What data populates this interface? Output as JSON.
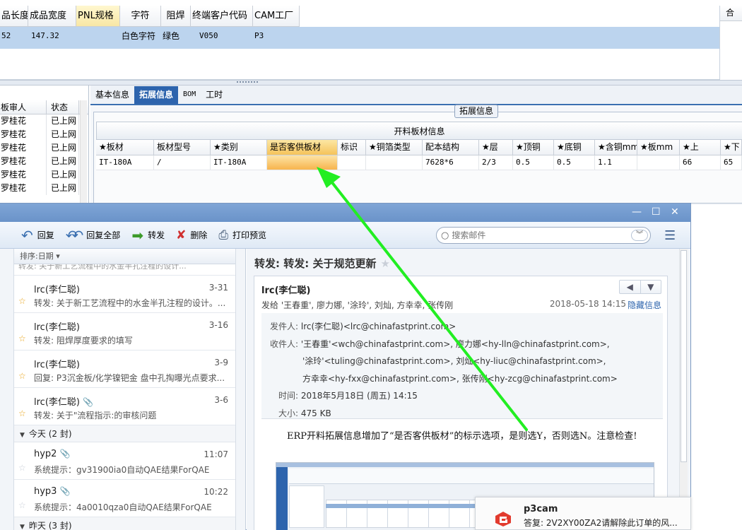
{
  "erp": {
    "grid": {
      "headers": [
        "品长度",
        "成品宽度",
        "PNL规格",
        "字符",
        "阻焊",
        "终端客户代码",
        "CAM工厂"
      ],
      "row": [
        "52",
        "147.32",
        "",
        "白色字符",
        "绿色",
        "V050",
        "P3",
        ""
      ],
      "right_header": "合"
    },
    "left_panel": {
      "headers": [
        "板审人",
        "状态"
      ],
      "rows": [
        [
          "罗桂花",
          "已上网"
        ],
        [
          "罗桂花",
          "已上网"
        ],
        [
          "罗桂花",
          "已上网"
        ],
        [
          "罗桂花",
          "已上网"
        ],
        [
          "罗桂花",
          "已上网"
        ],
        [
          "罗桂花",
          "已上网"
        ]
      ]
    },
    "tabs": [
      {
        "label": "基本信息",
        "active": false
      },
      {
        "label": "拓展信息",
        "active": true
      },
      {
        "label": "BOM",
        "active": false
      },
      {
        "label": "工时",
        "active": false
      }
    ],
    "group_title": "拓展信息",
    "sub_title": "开料板材信息",
    "sub_headers": [
      "★板材",
      "板材型号",
      "★类别",
      "是否客供板材",
      "标识",
      "★铜箔类型",
      "配本结构",
      "★层",
      "★顶铜",
      "★底铜",
      "★含铜mm",
      "★板mm",
      "★上",
      "★下"
    ],
    "sub_row": [
      "IT-180A",
      "/",
      "IT-180A",
      "",
      "",
      "",
      "7628*6",
      "2/3",
      "0.5",
      "0.5",
      "1.1",
      "",
      "66",
      "65"
    ]
  },
  "mail": {
    "window_controls": [
      "—",
      "☐",
      "✕"
    ],
    "toolbar": {
      "reply": "回复",
      "reply_all": "回复全部",
      "forward": "转发",
      "delete": "删除",
      "print_preview": "打印预览",
      "search_placeholder": "搜索邮件"
    },
    "list": {
      "sort_label": "排序:日期 ▾",
      "partial_text": "转发: 关于新工艺流程中的水金半孔注程的设计...",
      "items": [
        {
          "from": "lrc(李仁聪)",
          "date": "3-31",
          "subject": "转发: 关于新工艺流程中的水金半孔注程的设计。...",
          "starred": true,
          "attachment": false
        },
        {
          "from": "lrc(李仁聪)",
          "date": "3-16",
          "subject": "转发: 阻焊厚度要求的填写",
          "starred": true,
          "attachment": false
        },
        {
          "from": "lrc(李仁聪)",
          "date": "3-9",
          "subject": "回复: P3沉金板/化学镍钯金 盘中孔掏曝光点要求...",
          "starred": true,
          "attachment": false
        },
        {
          "from": "lrc(李仁聪)",
          "date": "3-6",
          "subject": "转发: 关于\"流程指示:的审核问题",
          "starred": true,
          "attachment": true
        }
      ],
      "group_today": "今天 (2 封)",
      "today_items": [
        {
          "from": "hyp2",
          "date": "11:07",
          "subject": "系统提示：gv31900ia0自动QAE结果ForQAE",
          "starred": false,
          "attachment": true
        },
        {
          "from": "hyp3",
          "date": "10:22",
          "subject": "系统提示：4a0010qza0自动QAE结果ForQAE",
          "starred": false,
          "attachment": true
        }
      ],
      "group_yesterday": "昨天 (3 封)"
    },
    "read": {
      "subject": "转发: 转发: 关于规范更新",
      "from_name": "lrc(李仁聪)",
      "to_summary": "发给 '王春重', 廖力娜, '涂玲', 刘灿, 方幸幸, 张传刚",
      "date": "2018-05-18 14:15",
      "hide_info": "隐藏信息",
      "details": {
        "sender_label": "发件人:",
        "sender": "lrc(李仁聪)<lrc@chinafastprint.com>",
        "recipient_label": "收件人:",
        "recipients_line1": "'王春重'<wch@chinafastprint.com>,  廖力娜<hy-lln@chinafastprint.com>,",
        "recipients_line2": "'涂玲'<tuling@chinafastprint.com>,  刘灿<hy-liuc@chinafastprint.com>,",
        "recipients_line3": "方幸幸<hy-fxx@chinafastprint.com>,  张传刚<hy-zcg@chinafastprint.com>",
        "time_label": "时间:",
        "time": "2018年5月18日 (周五) 14:15",
        "size_label": "大小:",
        "size": "475 KB"
      },
      "body": "ERP开料拓展信息增加了“是否客供板材”的标示选项，是则选Y，否则选N。注意检查!"
    }
  },
  "toast": {
    "title": "p3cam",
    "body": "答复: 2V2XY00ZA2请解除此订单的风..."
  },
  "colors": {
    "arrow": "#22ee22",
    "accent": "#2d64ad",
    "selected_row": "#bcd4ee",
    "highlight": "#f7b44d"
  }
}
